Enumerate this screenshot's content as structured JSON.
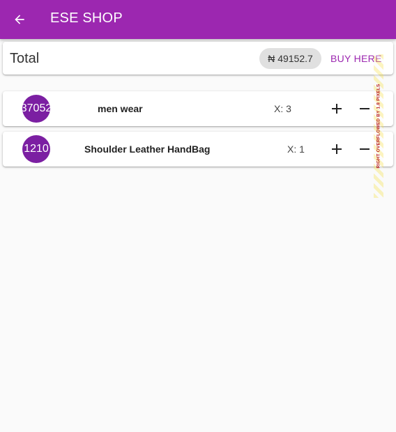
{
  "app_bar": {
    "title": "ESE SHOP",
    "back_icon": "arrow-back-icon",
    "color": "#9c27b0"
  },
  "total_card": {
    "label": "Total",
    "amount": "₦ 49152.7",
    "buy_label": "BUY HERE"
  },
  "cart_items": [
    {
      "avatar_text": "37052",
      "name": "men wear",
      "quantity": "X: 3",
      "plus_icon": "plus-icon",
      "minus_icon": "minus-icon"
    },
    {
      "avatar_text": "1210",
      "name": "Shoulder Leather HandBag",
      "quantity": "X: 1",
      "plus_icon": "plus-icon",
      "minus_icon": "minus-icon"
    }
  ],
  "debug_overflow": {
    "text": "RIGHT OVERFLOWED BY 1.8 PIXELS"
  },
  "colors": {
    "primary": "#9c27b0",
    "avatar": "#7b1fa2",
    "chip": "#e0e0e0",
    "background": "#fafafa"
  }
}
